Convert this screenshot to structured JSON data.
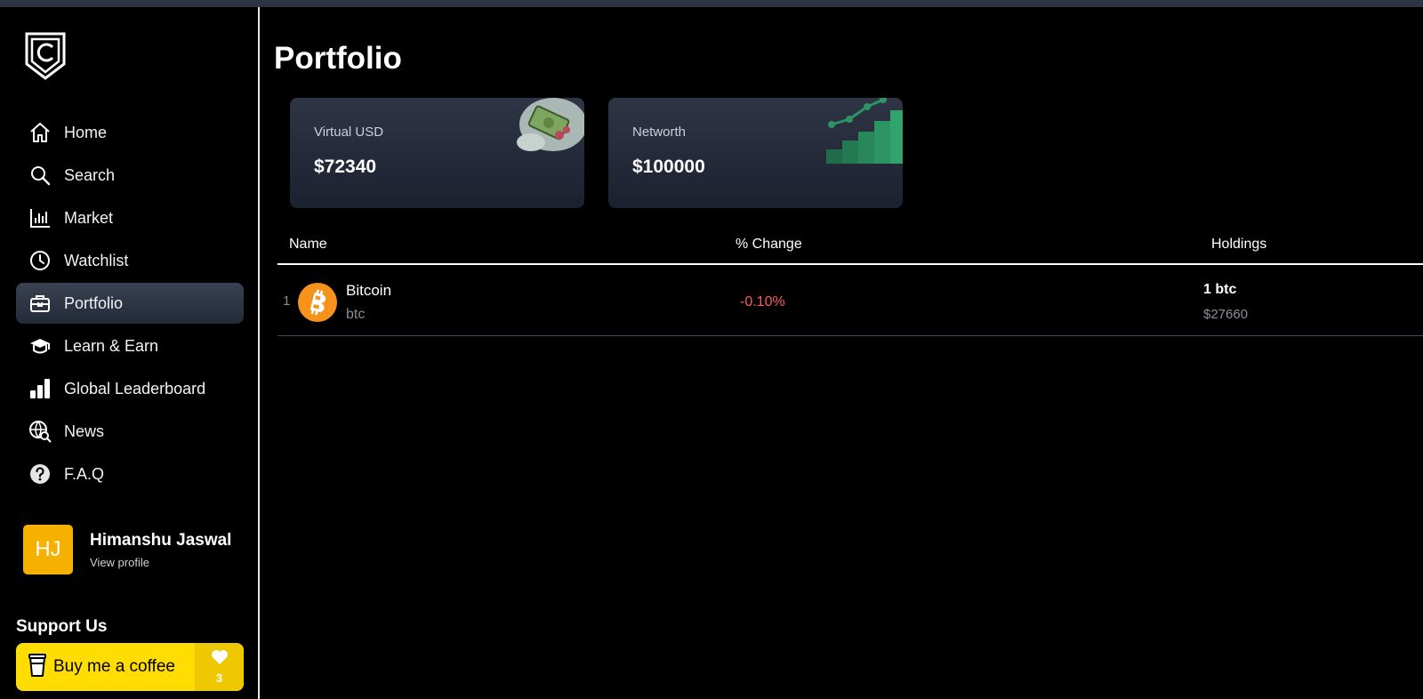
{
  "sidebar": {
    "items": [
      {
        "label": "Home",
        "icon": "home-icon"
      },
      {
        "label": "Search",
        "icon": "search-icon"
      },
      {
        "label": "Market",
        "icon": "bar-chart-icon"
      },
      {
        "label": "Watchlist",
        "icon": "clock-icon"
      },
      {
        "label": "Portfolio",
        "icon": "briefcase-icon",
        "active": true
      },
      {
        "label": "Learn & Earn",
        "icon": "graduation-cap-icon"
      },
      {
        "label": "Global Leaderboard",
        "icon": "leaderboard-icon"
      },
      {
        "label": "News",
        "icon": "globe-search-icon"
      },
      {
        "label": "F.A.Q",
        "icon": "help-icon"
      }
    ],
    "profile": {
      "initials": "HJ",
      "name": "Himanshu Jaswal",
      "link": "View profile"
    },
    "support": {
      "title": "Support Us",
      "button_label": "Buy me a coffee",
      "count": "3"
    }
  },
  "main": {
    "title": "Portfolio",
    "cards": [
      {
        "label": "Virtual USD",
        "value": "$72340"
      },
      {
        "label": "Networth",
        "value": "$100000"
      }
    ],
    "table": {
      "headers": {
        "name": "Name",
        "change": "% Change",
        "holdings": "Holdings"
      },
      "rows": [
        {
          "rank": "1",
          "name": "Bitcoin",
          "symbol": "btc",
          "change": "-0.10%",
          "quantity": "1 btc",
          "value": "$27660"
        }
      ]
    }
  },
  "colors": {
    "accent_active": "#2c3343",
    "negative": "#ff5c5c",
    "coffee": "#ffdd00",
    "avatar": "#f5b000",
    "bitcoin": "#f7931a"
  }
}
